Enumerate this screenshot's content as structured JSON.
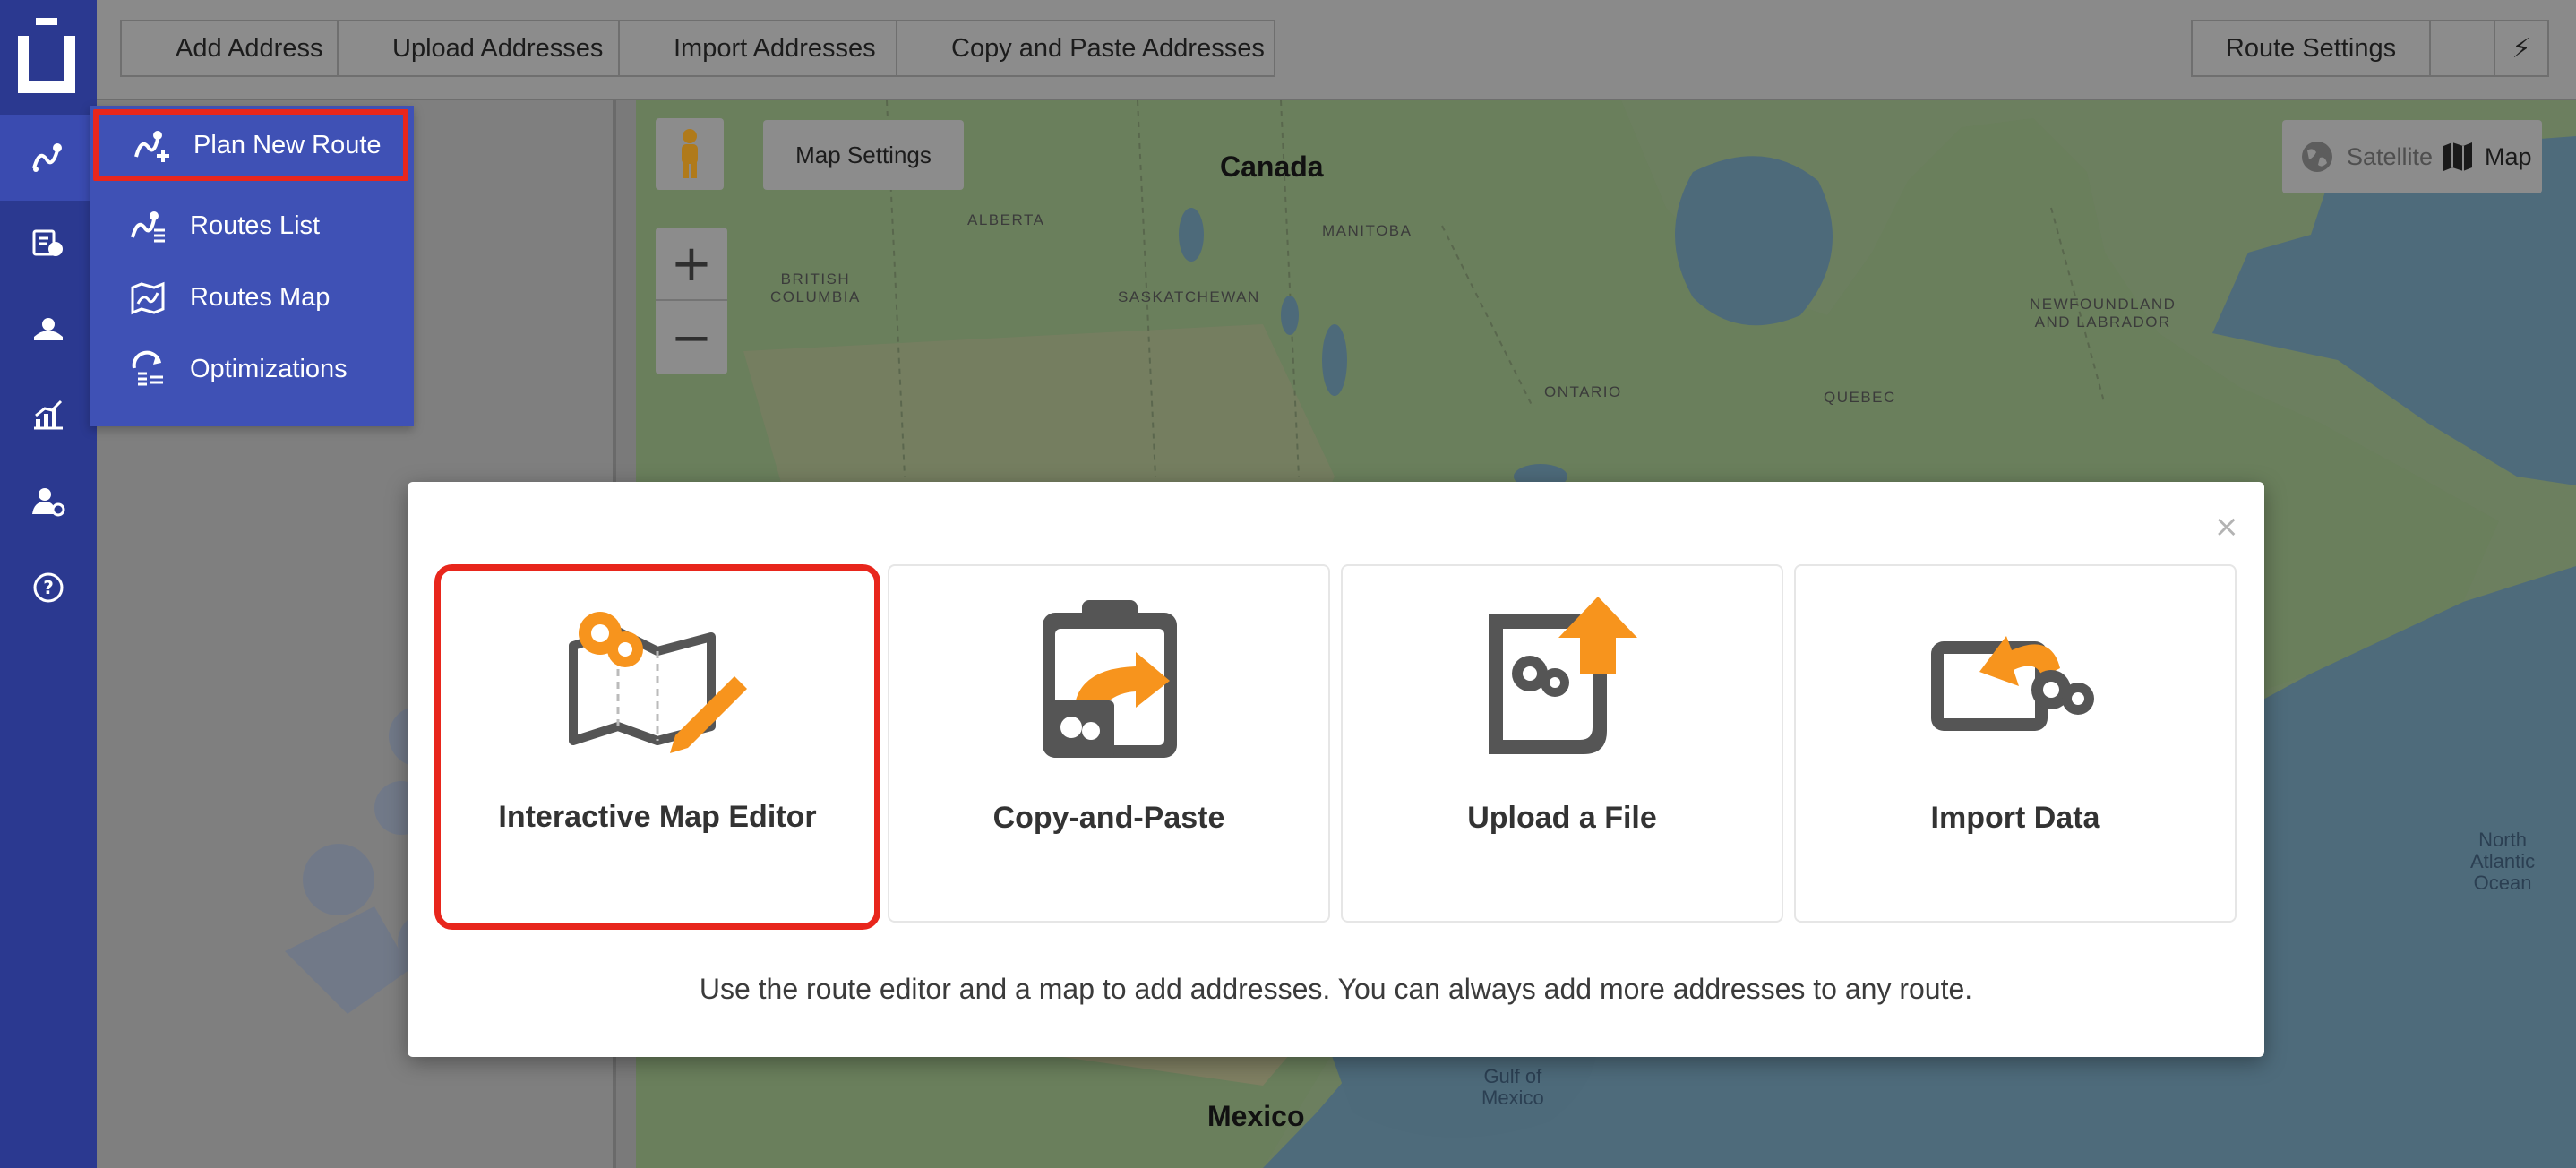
{
  "toolbar": {
    "buttons": [
      "Add Address",
      "Upload Addresses",
      "Import Addresses",
      "Copy and Paste Addresses"
    ],
    "route_settings": "Route Settings",
    "bolt": "⚡"
  },
  "rail": {
    "items": [
      {
        "icon": "routes-icon",
        "active": true
      },
      {
        "icon": "orders-icon",
        "active": false
      },
      {
        "icon": "drivers-icon",
        "active": false
      },
      {
        "icon": "analytics-icon",
        "active": false
      },
      {
        "icon": "team-settings-icon",
        "active": false
      },
      {
        "icon": "help-icon",
        "active": false
      }
    ]
  },
  "menu": {
    "items": [
      {
        "label": "Plan New Route",
        "icon": "plan-route-icon",
        "highlighted": true
      },
      {
        "label": "Routes List",
        "icon": "routes-list-icon",
        "highlighted": false
      },
      {
        "label": "Routes Map",
        "icon": "routes-map-icon",
        "highlighted": false
      },
      {
        "label": "Optimizations",
        "icon": "optimizations-icon",
        "highlighted": false
      }
    ]
  },
  "map": {
    "settings_label": "Map Settings",
    "zoom_in": "+",
    "zoom_out": "−",
    "satellite_label": "Satellite",
    "map_label": "Map",
    "labels": {
      "canada": "Canada",
      "mexico": "Mexico",
      "alberta": "ALBERTA",
      "manitoba": "MANITOBA",
      "british_columbia_1": "BRITISH",
      "british_columbia_2": "COLUMBIA",
      "saskatchewan": "SASKATCHEWAN",
      "ontario": "ONTARIO",
      "quebec": "QUEBEC",
      "newfoundland_1": "NEWFOUNDLAND",
      "newfoundland_2": "AND LABRADOR",
      "gulf_1": "Gulf of",
      "gulf_2": "Mexico",
      "atlantic_1": "North",
      "atlantic_2": "Atlantic",
      "atlantic_3": "Ocean"
    }
  },
  "modal": {
    "close": "×",
    "cards": [
      {
        "label": "Interactive Map Editor",
        "icon": "map-editor-icon",
        "selected": true
      },
      {
        "label": "Copy-and-Paste",
        "icon": "clipboard-paste-icon",
        "selected": false
      },
      {
        "label": "Upload a File",
        "icon": "upload-file-icon",
        "selected": false
      },
      {
        "label": "Import Data",
        "icon": "import-data-icon",
        "selected": false
      }
    ],
    "description": "Use the route editor and a map to add addresses. You can always add more addresses to any route."
  },
  "colors": {
    "rail": "#2b3990",
    "menu": "#3f51b5",
    "highlight": "#e8261c",
    "accent_orange": "#f7941d",
    "icon_gray": "#555555"
  }
}
